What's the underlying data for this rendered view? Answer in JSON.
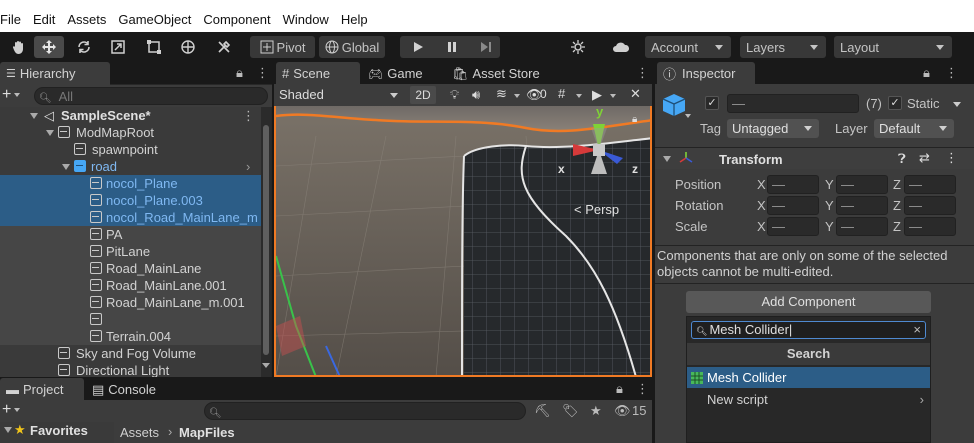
{
  "menu": [
    "File",
    "Edit",
    "Assets",
    "GameObject",
    "Component",
    "Window",
    "Help"
  ],
  "toolbar": {
    "pivot": "Pivot",
    "global": "Global",
    "account": "Account",
    "layers": "Layers",
    "layout": "Layout"
  },
  "hierarchy": {
    "tab": "Hierarchy",
    "search_placeholder": "All",
    "items": [
      {
        "label": "SampleScene*"
      },
      {
        "label": "ModMapRoot"
      },
      {
        "label": "spawnpoint"
      },
      {
        "label": "road"
      },
      {
        "label": "nocol_Plane"
      },
      {
        "label": "nocol_Plane.003"
      },
      {
        "label": "nocol_Road_MainLane_m"
      },
      {
        "label": "PA"
      },
      {
        "label": "PitLane"
      },
      {
        "label": "Road_MainLane"
      },
      {
        "label": "Road_MainLane.001"
      },
      {
        "label": "Road_MainLane_m.001"
      },
      {
        "label": ""
      },
      {
        "label": "Terrain.004"
      },
      {
        "label": "Sky and Fog Volume"
      },
      {
        "label": "Directional Light"
      }
    ]
  },
  "scene": {
    "tabs": [
      "Scene",
      "Game",
      "Asset Store"
    ],
    "shading": "Shaded",
    "mode_2d": "2D",
    "hidden_count": "0",
    "persp_label": "< Persp",
    "axis_x": "x",
    "axis_y": "y",
    "axis_z": "z"
  },
  "inspector": {
    "tab": "Inspector",
    "name_value": "—",
    "count": "(7)",
    "static_label": "Static",
    "tag_label": "Tag",
    "tag_value": "Untagged",
    "layer_label": "Layer",
    "layer_value": "Default",
    "transform_title": "Transform",
    "rows": [
      {
        "label": "Position",
        "x": "—",
        "y": "—",
        "z": "—"
      },
      {
        "label": "Rotation",
        "x": "—",
        "y": "—",
        "z": "—"
      },
      {
        "label": "Scale",
        "x": "—",
        "y": "—",
        "z": "—"
      }
    ],
    "axis_labels": [
      "X",
      "Y",
      "Z"
    ],
    "notice": "Components that are only on some of the selected objects cannot be multi-edited.",
    "add_component": "Add Component",
    "search_value": "Mesh Collider",
    "search_header": "Search",
    "results": [
      "Mesh Collider",
      "New script"
    ]
  },
  "project": {
    "tabs": [
      "Project",
      "Console"
    ],
    "favorites": "Favorites",
    "breadcrumb_root": "Assets",
    "breadcrumb_current": "MapFiles",
    "hidden_count": "15"
  },
  "colors": {
    "selection_blue": "#2c5d87",
    "selected_row": "#464646",
    "accent_orange": "#f07a24"
  }
}
